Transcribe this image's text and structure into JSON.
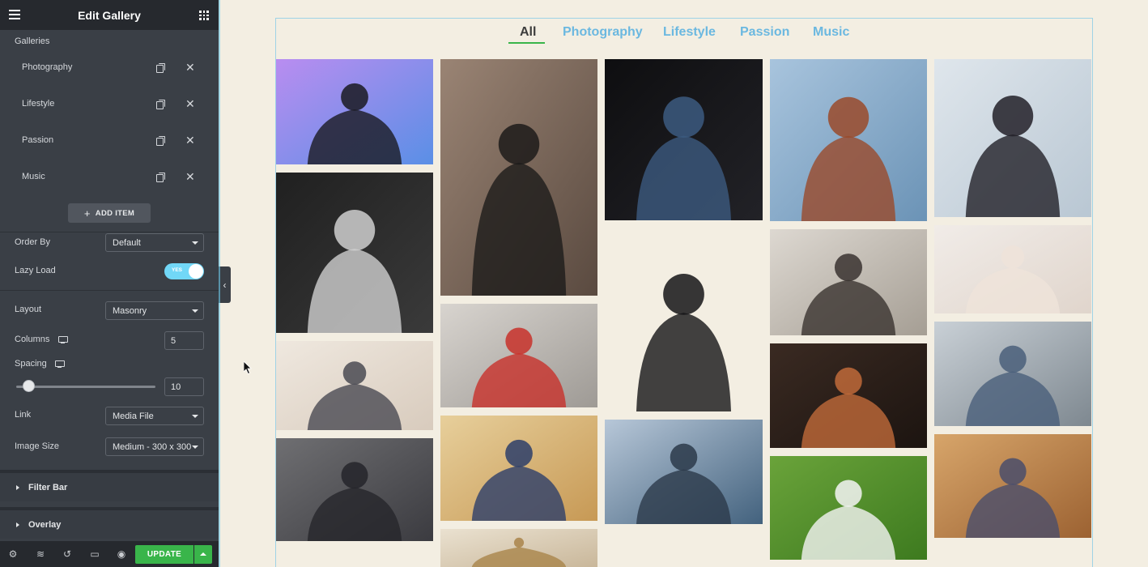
{
  "sidebar": {
    "header_title": "Edit Gallery",
    "galleries_label": "Galleries",
    "gallery_items": [
      {
        "label": "Photography"
      },
      {
        "label": "Lifestyle"
      },
      {
        "label": "Passion"
      },
      {
        "label": "Music"
      }
    ],
    "add_item_label": "ADD ITEM",
    "order_by": {
      "label": "Order By",
      "value": "Default"
    },
    "lazy_load": {
      "label": "Lazy Load",
      "state": "YES"
    },
    "layout": {
      "label": "Layout",
      "value": "Masonry"
    },
    "columns": {
      "label": "Columns",
      "value": "5"
    },
    "spacing": {
      "label": "Spacing",
      "value": "10",
      "slider_fraction": 0.1
    },
    "link": {
      "label": "Link",
      "value": "Media File"
    },
    "image_size": {
      "label": "Image Size",
      "value": "Medium - 300 x 300"
    },
    "sections": [
      "Filter Bar",
      "Overlay"
    ],
    "footer": {
      "icons": [
        "settings-icon",
        "layers-icon",
        "history-icon",
        "responsive-icon",
        "preview-icon"
      ],
      "update_label": "UPDATE"
    }
  },
  "gallery": {
    "filters": [
      "All",
      "Photography",
      "Lifestyle",
      "Passion",
      "Music"
    ],
    "active_filter": "All",
    "photos": [
      {
        "name": "photo-photographer-silhouette",
        "bg": [
          "#b98df0",
          "#5a8fe6"
        ],
        "subject": "#1a1a22"
      },
      {
        "name": "photo-smiling-man-bw",
        "bg": [
          "#202020",
          "#3a3a3a"
        ],
        "subject": "#cfcfcf"
      },
      {
        "name": "photo-laptop-hands",
        "bg": [
          "#efe8df",
          "#d8cbbd"
        ],
        "subject": "#4a4a52"
      },
      {
        "name": "photo-city-street",
        "bg": [
          "#6f6f72",
          "#3b3b40"
        ],
        "subject": "#25252a"
      },
      {
        "name": "photo-hiker-photographer",
        "bg": [
          "#9a8474",
          "#5a4a40"
        ],
        "subject": "#1d1b1a"
      },
      {
        "name": "photo-woman-laptop-lamp",
        "bg": [
          "#d8d4cf",
          "#9e9a95"
        ],
        "subject": "#c8312a"
      },
      {
        "name": "photo-ukulele-player",
        "bg": [
          "#e7cf9b",
          "#c79955"
        ],
        "subject": "#2d3e6a"
      },
      {
        "name": "photo-crown-chess",
        "bg": [
          "#eae1d0",
          "#c9b79a"
        ],
        "subject": "#a9844a"
      },
      {
        "name": "photo-man-camera-lens",
        "bg": [
          "#0e0e10",
          "#222227"
        ],
        "subject": "#3c5a80"
      },
      {
        "name": "photo-presenter-black-sweater",
        "bg": [
          "#f3eee2",
          "#f3eee2"
        ],
        "subject": "#141416"
      },
      {
        "name": "photo-fisherman-lake",
        "bg": [
          "#b7c7d8",
          "#43627e"
        ],
        "subject": "#2c3a4a"
      },
      {
        "name": "photo-redhead-woman",
        "bg": [
          "#a8c4dd",
          "#6b93b6"
        ],
        "subject": "#9a4a2a"
      },
      {
        "name": "photo-woman-desk-laptop",
        "bg": [
          "#ddd8d1",
          "#a59e94"
        ],
        "subject": "#3a3330"
      },
      {
        "name": "photo-paint-palette",
        "bg": [
          "#3a2a22",
          "#1c1410"
        ],
        "subject": "#c06a3a"
      },
      {
        "name": "photo-golf-ball-green",
        "bg": [
          "#6aa33a",
          "#3d7a1f"
        ],
        "subject": "#f4f4f4"
      },
      {
        "name": "photo-woman-dark-hair",
        "bg": [
          "#dfe6ec",
          "#b9c7d3"
        ],
        "subject": "#222028"
      },
      {
        "name": "photo-woman-white-blazer",
        "bg": [
          "#f1ece8",
          "#e0d5cc"
        ],
        "subject": "#efe3d9"
      },
      {
        "name": "photo-woman-sitting-room",
        "bg": [
          "#c9d0d6",
          "#7e8890"
        ],
        "subject": "#4a5f7a"
      },
      {
        "name": "photo-guitar-closeup",
        "bg": [
          "#d7a56a",
          "#9c6232"
        ],
        "subject": "#4a4e6b"
      }
    ]
  },
  "colors": {
    "accent_green": "#39b54a",
    "filter_blue": "#6bb8e0",
    "sidebar_bg": "#3a3f46",
    "canvas_bg": "#f3eee2"
  }
}
